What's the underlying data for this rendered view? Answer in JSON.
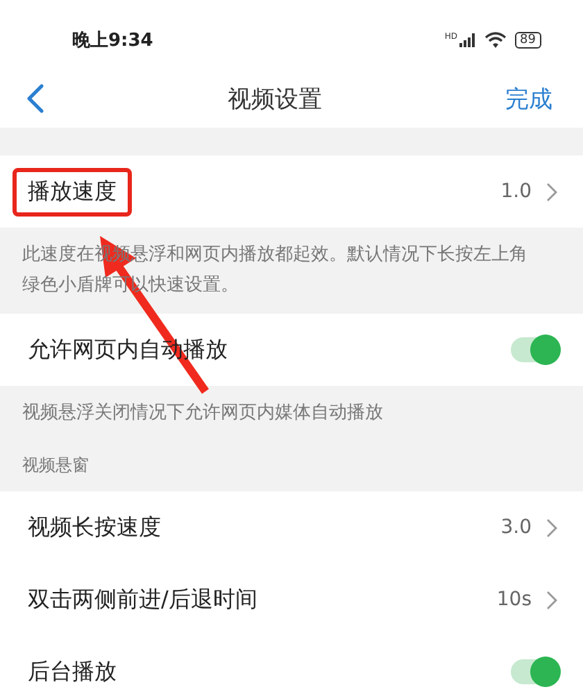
{
  "status_bar": {
    "time": "晚上9:34",
    "signal_label": "HD",
    "battery": "89"
  },
  "nav": {
    "title": "视频设置",
    "action": "完成"
  },
  "items": [
    {
      "kind": "gap"
    },
    {
      "kind": "row",
      "label": "播放速度",
      "value": "1.0",
      "highlighted": true
    },
    {
      "kind": "note",
      "text": "此速度在视频悬浮和网页内播放都起效。默认情况下长按左上角绿色小盾牌可以快速设置。"
    },
    {
      "kind": "toggle",
      "label": "允许网页内自动播放",
      "on": true
    },
    {
      "kind": "note",
      "text": "视频悬浮关闭情况下允许网页内媒体自动播放"
    },
    {
      "kind": "header",
      "text": "视频悬窗"
    },
    {
      "kind": "row",
      "label": "视频长按速度",
      "value": "3.0",
      "highlighted": false
    },
    {
      "kind": "row",
      "label": "双击两侧前进/后退时间",
      "value": "10s",
      "highlighted": false
    },
    {
      "kind": "toggle",
      "label": "后台播放",
      "on": true
    }
  ]
}
